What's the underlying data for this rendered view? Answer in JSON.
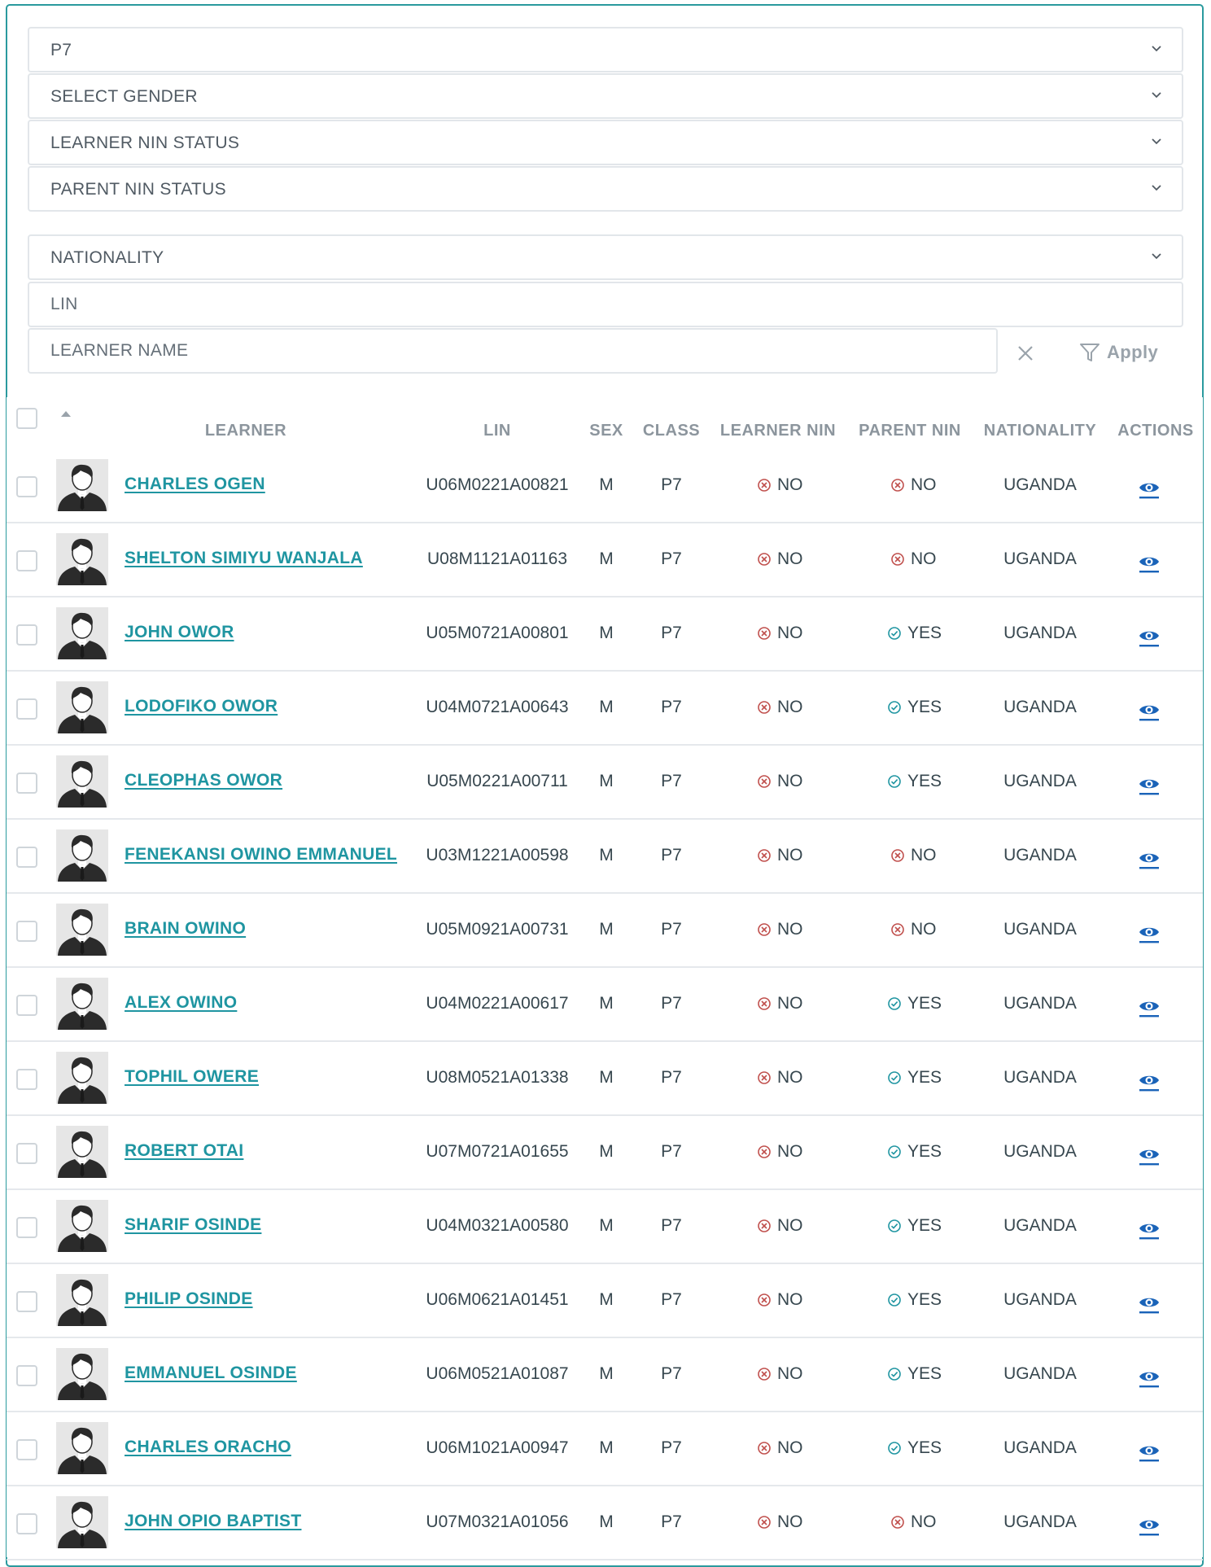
{
  "filters": {
    "class_value": "P7",
    "gender_value": "SELECT GENDER",
    "learner_nin_value": "LEARNER NIN STATUS",
    "parent_nin_value": "PARENT NIN STATUS",
    "nationality_value": "NATIONALITY",
    "lin_placeholder": "LIN",
    "name_placeholder": "LEARNER NAME",
    "apply_label": "Apply"
  },
  "colors": {
    "accent": "#1f95a1",
    "border_teal": "#2a9a9e",
    "no_icon": "#c0504d",
    "yes_icon": "#1f95a1",
    "action_icon": "#1a63b8"
  },
  "table": {
    "headers": {
      "learner": "LEARNER",
      "lin": "LIN",
      "sex": "SEX",
      "class": "CLASS",
      "learner_nin": "LEARNER NIN",
      "parent_nin": "PARENT NIN",
      "nationality": "NATIONALITY",
      "actions": "ACTIONS"
    },
    "rows": [
      {
        "name": "CHARLES OGEN",
        "lin": "U06M0221A00821",
        "sex": "M",
        "class": "P7",
        "learner_nin": "NO",
        "parent_nin": "NO",
        "nationality": "UGANDA"
      },
      {
        "name": "SHELTON SIMIYU WANJALA",
        "lin": "U08M1121A01163",
        "sex": "M",
        "class": "P7",
        "learner_nin": "NO",
        "parent_nin": "NO",
        "nationality": "UGANDA"
      },
      {
        "name": "JOHN OWOR",
        "lin": "U05M0721A00801",
        "sex": "M",
        "class": "P7",
        "learner_nin": "NO",
        "parent_nin": "YES",
        "nationality": "UGANDA"
      },
      {
        "name": "LODOFIKO OWOR",
        "lin": "U04M0721A00643",
        "sex": "M",
        "class": "P7",
        "learner_nin": "NO",
        "parent_nin": "YES",
        "nationality": "UGANDA"
      },
      {
        "name": "CLEOPHAS OWOR",
        "lin": "U05M0221A00711",
        "sex": "M",
        "class": "P7",
        "learner_nin": "NO",
        "parent_nin": "YES",
        "nationality": "UGANDA"
      },
      {
        "name": "FENEKANSI OWINO EMMANUEL",
        "lin": "U03M1221A00598",
        "sex": "M",
        "class": "P7",
        "learner_nin": "NO",
        "parent_nin": "NO",
        "nationality": "UGANDA"
      },
      {
        "name": "BRAIN OWINO",
        "lin": "U05M0921A00731",
        "sex": "M",
        "class": "P7",
        "learner_nin": "NO",
        "parent_nin": "NO",
        "nationality": "UGANDA"
      },
      {
        "name": "ALEX OWINO",
        "lin": "U04M0221A00617",
        "sex": "M",
        "class": "P7",
        "learner_nin": "NO",
        "parent_nin": "YES",
        "nationality": "UGANDA"
      },
      {
        "name": "TOPHIL OWERE",
        "lin": "U08M0521A01338",
        "sex": "M",
        "class": "P7",
        "learner_nin": "NO",
        "parent_nin": "YES",
        "nationality": "UGANDA"
      },
      {
        "name": "ROBERT OTAI",
        "lin": "U07M0721A01655",
        "sex": "M",
        "class": "P7",
        "learner_nin": "NO",
        "parent_nin": "YES",
        "nationality": "UGANDA"
      },
      {
        "name": "SHARIF OSINDE",
        "lin": "U04M0321A00580",
        "sex": "M",
        "class": "P7",
        "learner_nin": "NO",
        "parent_nin": "YES",
        "nationality": "UGANDA"
      },
      {
        "name": "PHILIP OSINDE",
        "lin": "U06M0621A01451",
        "sex": "M",
        "class": "P7",
        "learner_nin": "NO",
        "parent_nin": "YES",
        "nationality": "UGANDA"
      },
      {
        "name": "EMMANUEL OSINDE",
        "lin": "U06M0521A01087",
        "sex": "M",
        "class": "P7",
        "learner_nin": "NO",
        "parent_nin": "YES",
        "nationality": "UGANDA"
      },
      {
        "name": "CHARLES ORACHO",
        "lin": "U06M1021A00947",
        "sex": "M",
        "class": "P7",
        "learner_nin": "NO",
        "parent_nin": "YES",
        "nationality": "UGANDA"
      },
      {
        "name": "JOHN OPIO BAPTIST",
        "lin": "U07M0321A01056",
        "sex": "M",
        "class": "P7",
        "learner_nin": "NO",
        "parent_nin": "NO",
        "nationality": "UGANDA"
      }
    ]
  }
}
